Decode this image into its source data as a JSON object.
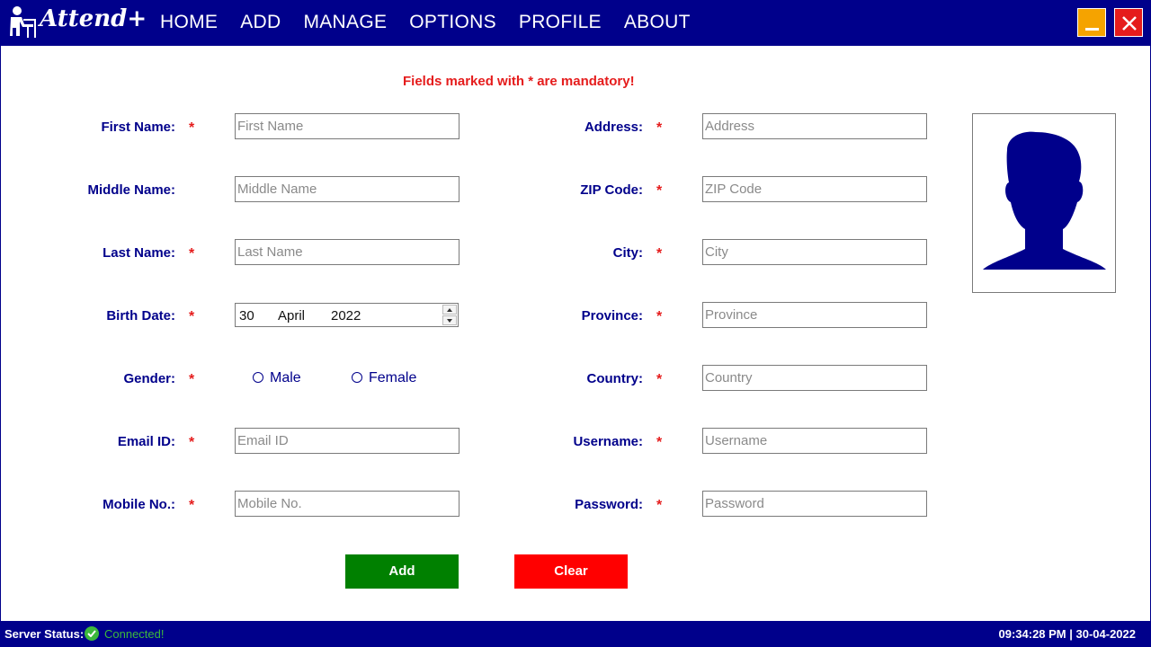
{
  "app": {
    "brand": "Attend+"
  },
  "nav": [
    "HOME",
    "ADD",
    "MANAGE",
    "OPTIONS",
    "PROFILE",
    "ABOUT"
  ],
  "notice": "Fields marked with * are mandatory!",
  "required_mark": "*",
  "left_fields": [
    {
      "label": "First Name:",
      "placeholder": "First Name",
      "required": true
    },
    {
      "label": "Middle Name:",
      "placeholder": "Middle Name",
      "required": false
    },
    {
      "label": "Last Name:",
      "placeholder": "Last Name",
      "required": true
    },
    {
      "label": "Birth Date:",
      "required": true
    },
    {
      "label": "Gender:",
      "required": true
    },
    {
      "label": "Email ID:",
      "placeholder": "Email ID",
      "required": true
    },
    {
      "label": "Mobile No.:",
      "placeholder": "Mobile No.",
      "required": true
    }
  ],
  "right_fields": [
    {
      "label": "Address:",
      "placeholder": "Address",
      "required": true
    },
    {
      "label": "ZIP Code:",
      "placeholder": "ZIP Code",
      "required": true
    },
    {
      "label": "City:",
      "placeholder": "City",
      "required": true
    },
    {
      "label": "Province:",
      "placeholder": "Province",
      "required": true
    },
    {
      "label": "Country:",
      "placeholder": "Country",
      "required": true
    },
    {
      "label": "Username:",
      "placeholder": "Username",
      "required": true
    },
    {
      "label": "Password:",
      "placeholder": "Password",
      "required": true
    }
  ],
  "birth_date": {
    "day": "30",
    "month": "April",
    "year": "2022"
  },
  "gender_options": [
    "Male",
    "Female"
  ],
  "buttons": {
    "add": "Add",
    "clear": "Clear"
  },
  "status": {
    "label": "Server Status:",
    "value": "Connected!"
  },
  "clock": "09:34:28 PM | 30-04-2022",
  "colors": {
    "primary": "#00008b",
    "required": "#e51c1c",
    "add": "#008000",
    "clear": "#ff0000",
    "connected": "#3cb83c",
    "minimize": "#f5a300"
  },
  "icons": {
    "logo": "teacher-desk-icon",
    "minimize": "minimize-icon",
    "close": "close-icon",
    "photo": "user-silhouette-icon",
    "status": "check-circle-icon"
  }
}
